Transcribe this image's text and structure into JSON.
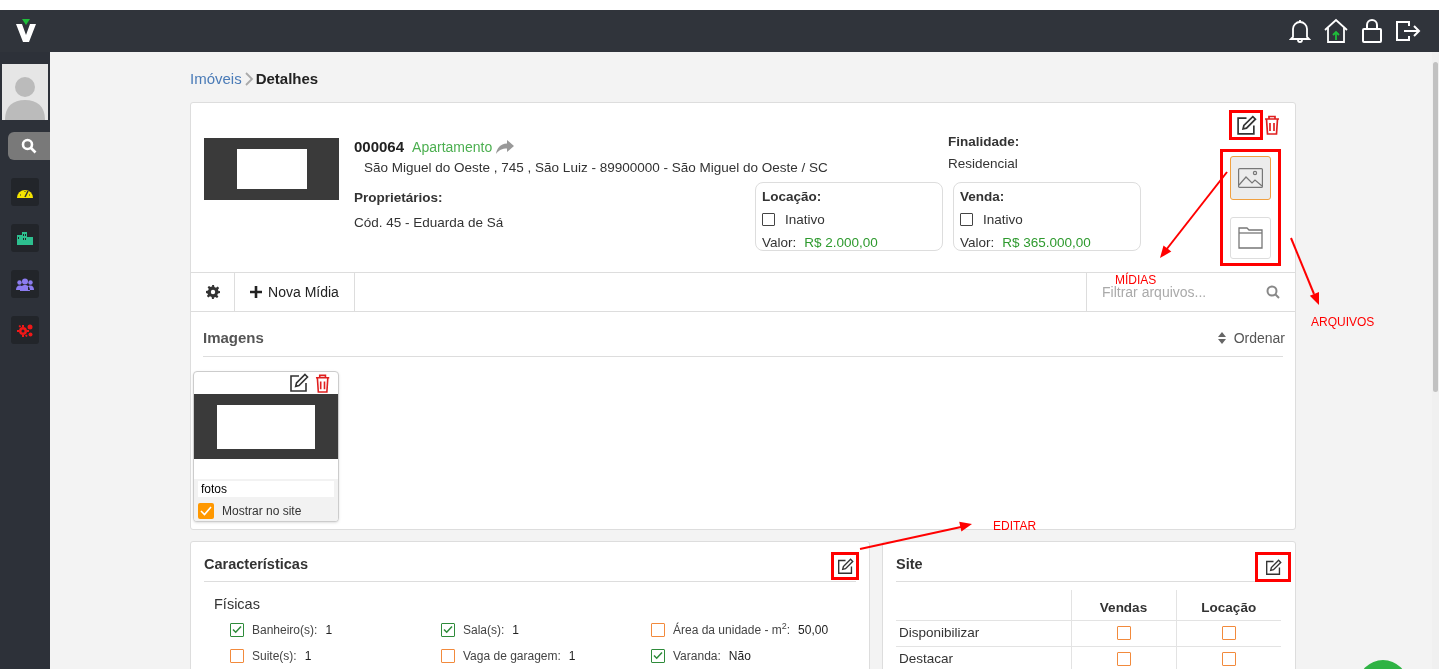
{
  "sidebar": {
    "items": [
      {
        "kind": "search",
        "selected": true
      },
      {
        "kind": "dashboard",
        "selected": false
      },
      {
        "kind": "buildings",
        "selected": false
      },
      {
        "kind": "people",
        "selected": false
      },
      {
        "kind": "settings",
        "selected": false
      }
    ]
  },
  "breadcrumb": [
    {
      "label": "Imóveis",
      "link": true
    },
    {
      "label": "Detalhes",
      "link": false
    }
  ],
  "property": {
    "code": "000064",
    "type": "Apartamento",
    "address": "São Miguel do Oeste , 745 , São Luiz - 89900000 - São Miguel do Oeste / SC",
    "owners_label": "Proprietários:",
    "owners": "Cód. 45 - Eduarda de Sá",
    "purpose_label": "Finalidade:",
    "purpose": "Residencial",
    "edit_highlighted": true,
    "media_tabs_highlighted": true,
    "deals": [
      {
        "title": "Locação:",
        "status": "Inativo",
        "checked": false,
        "value_label": "Valor:",
        "value": "R$ 2.000,00"
      },
      {
        "title": "Venda:",
        "status": "Inativo",
        "checked": false,
        "value_label": "Valor:",
        "value": "R$ 365.000,00"
      }
    ],
    "media_tabs": [
      {
        "kind": "images",
        "selected": true
      },
      {
        "kind": "files",
        "selected": false
      }
    ]
  },
  "toolbar": {
    "new_button": "Nova Mídia",
    "filter_placeholder": "Filtrar arquivos..."
  },
  "images_section": {
    "title": "Imagens",
    "sort": "Ordenar",
    "items": [
      {
        "caption": "fotos",
        "show_label": "Mostrar no site",
        "show_on_site": true
      }
    ]
  },
  "features": {
    "title": "Características",
    "edit_highlighted": true,
    "group": "Físicas",
    "items": [
      {
        "label": "Banheiro(s):",
        "value": "1",
        "checked": true
      },
      {
        "label": "Sala(s):",
        "value": "1",
        "checked": true
      },
      {
        "label": "Área da unidade - m$^{2}$:",
        "value": "50,00",
        "checked": false
      },
      {
        "label": "Suite(s):",
        "value": "1",
        "checked": false
      },
      {
        "label": "Vaga de garagem:",
        "value": "1",
        "checked": false
      },
      {
        "label": "Varanda:",
        "value": "Não",
        "checked": true
      }
    ]
  },
  "site": {
    "title": "Site",
    "edit_highlighted": true,
    "columns": [
      "Vendas",
      "Locação"
    ],
    "rows": [
      {
        "label": "Disponibilizar",
        "cells": [
          {
            "checked": false
          },
          {
            "checked": false
          }
        ]
      },
      {
        "label": "Destacar",
        "cells": [
          {
            "checked": false
          },
          {
            "checked": false
          }
        ]
      }
    ]
  },
  "annotations": [
    {
      "label": "MÍDIAS"
    },
    {
      "label": "ARQUIVOS"
    },
    {
      "label": "EDITAR"
    }
  ]
}
